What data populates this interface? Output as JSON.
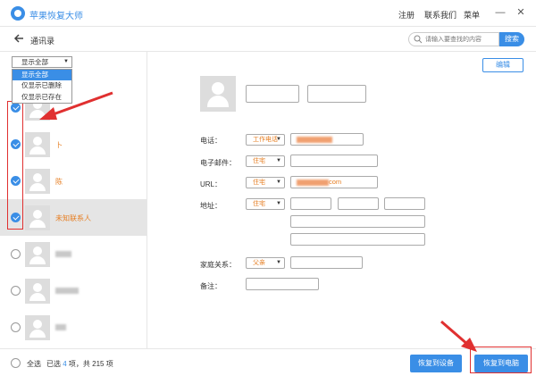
{
  "app": {
    "title": "苹果恢复大师"
  },
  "titlebar": {
    "menu": [
      "注册",
      "联系我们",
      "菜单"
    ],
    "minimize": "—",
    "close": "✕"
  },
  "header": {
    "title": "通讯录",
    "search_placeholder": "请输入要查找的内容",
    "search_button": "搜索"
  },
  "filter": {
    "selected": "显示全部",
    "options": [
      "显示全部",
      "仅显示已删除",
      "仅显示已存在"
    ]
  },
  "contacts": [
    {
      "name": "",
      "checked": true,
      "selected": false,
      "blurred": false
    },
    {
      "name": "卜",
      "checked": true,
      "selected": false,
      "blurred": false
    },
    {
      "name": "陈",
      "checked": true,
      "selected": false,
      "blurred": false
    },
    {
      "name": "未知联系人",
      "checked": true,
      "selected": true,
      "blurred": false
    },
    {
      "name": "",
      "checked": false,
      "selected": false,
      "blurred": true
    },
    {
      "name": "",
      "checked": false,
      "selected": false,
      "blurred": true
    },
    {
      "name": "",
      "checked": false,
      "selected": false,
      "blurred": true
    }
  ],
  "detail": {
    "edit_button": "编辑",
    "labels": {
      "phone": "电话：",
      "email": "电子邮件：",
      "url": "URL：",
      "address": "地址：",
      "family": "家庭关系：",
      "note": "备注："
    },
    "phone_type": "工作电话",
    "email_type": "住宅",
    "url_type": "住宅",
    "url_value": "com",
    "address_type": "住宅",
    "family_type": "父亲"
  },
  "bottombar": {
    "select_all": "全选",
    "summary_prefix": "已选",
    "selected_count": "4",
    "summary_suffix": "项，共 215 项",
    "restore_device": "恢复到设备",
    "restore_pc": "恢复到电脑"
  },
  "colors": {
    "accent": "#3a8ee6",
    "highlight": "#e67e22",
    "annotation": "#e03030"
  }
}
